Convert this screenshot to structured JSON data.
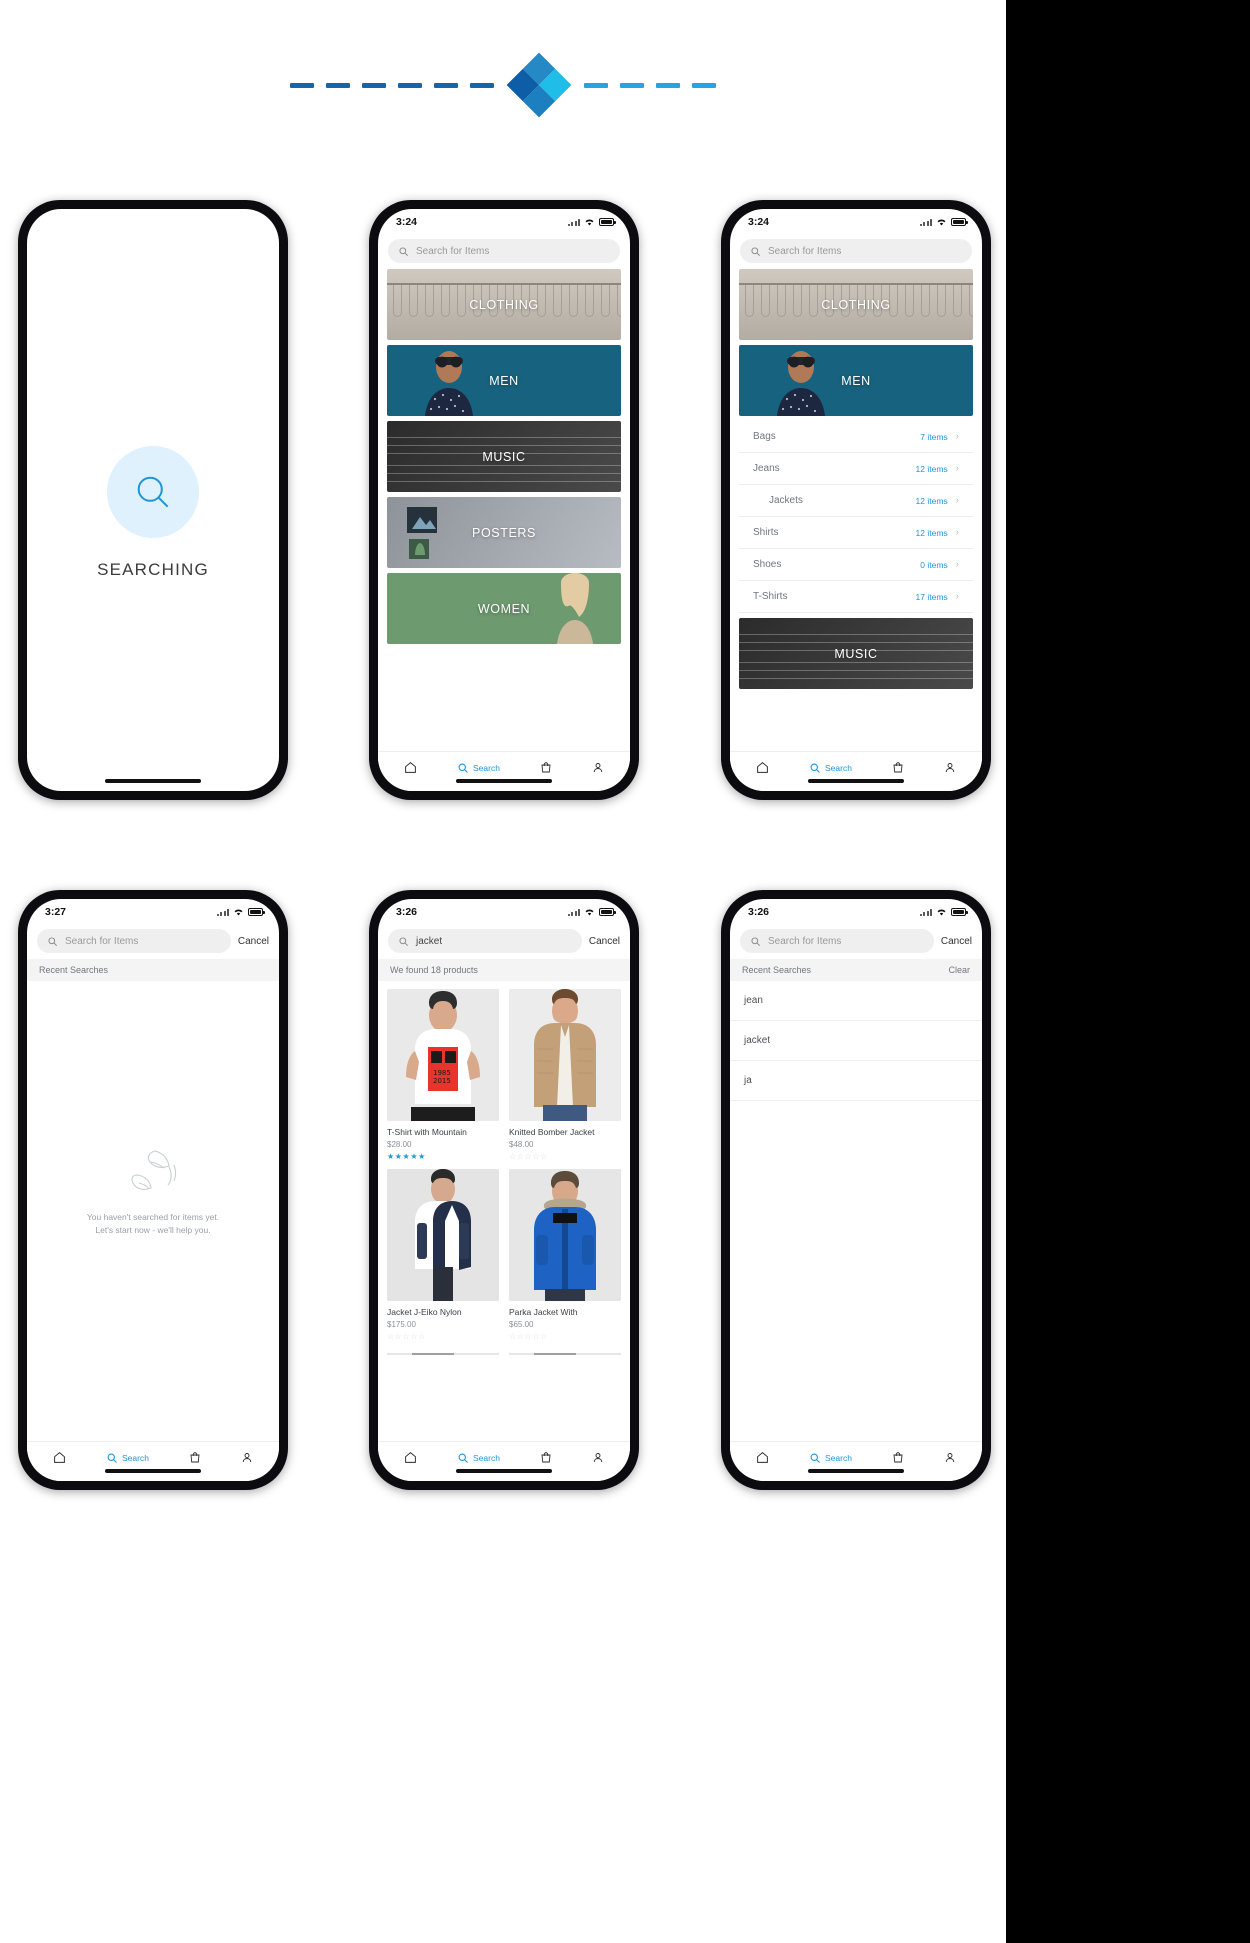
{
  "logo": {
    "name": "diamond-logo",
    "colors": [
      "#2489c4",
      "#1b7fc0",
      "#0d5ea6",
      "#1fbde8"
    ],
    "dash_color": "#1565a8"
  },
  "accent_color": "#2196d6",
  "common": {
    "search_placeholder": "Search for Items",
    "cancel_label": "Cancel",
    "nav": [
      {
        "icon": "home-icon",
        "label": ""
      },
      {
        "icon": "search-icon",
        "label": "Search"
      },
      {
        "icon": "bag-icon",
        "label": ""
      },
      {
        "icon": "person-icon",
        "label": ""
      }
    ]
  },
  "screens": [
    {
      "id": "searching",
      "status": {
        "time": "",
        "show": false
      },
      "searching_label": "SEARCHING",
      "icon": "search-icon"
    },
    {
      "id": "categories",
      "status": {
        "time": "3:24",
        "show": true
      },
      "search_value": "",
      "tiles": [
        {
          "label": "CLOTHING",
          "style": "clothing"
        },
        {
          "label": "MEN",
          "style": "men"
        },
        {
          "label": "MUSIC",
          "style": "music"
        },
        {
          "label": "POSTERS",
          "style": "posters"
        },
        {
          "label": "WOMEN",
          "style": "women"
        }
      ]
    },
    {
      "id": "category-expanded",
      "status": {
        "time": "3:24",
        "show": true
      },
      "search_value": "",
      "tiles_top": [
        {
          "label": "CLOTHING",
          "style": "clothing"
        },
        {
          "label": "MEN",
          "style": "men"
        }
      ],
      "subcategories": [
        {
          "name": "Bags",
          "count": "7 items",
          "indent": false
        },
        {
          "name": "Jeans",
          "count": "12 items",
          "indent": false
        },
        {
          "name": "Jackets",
          "count": "12 items",
          "indent": true
        },
        {
          "name": "Shirts",
          "count": "12 items",
          "indent": false
        },
        {
          "name": "Shoes",
          "count": "0 items",
          "indent": false
        },
        {
          "name": "T-Shirts",
          "count": "17 items",
          "indent": false
        }
      ],
      "tiles_bottom": [
        {
          "label": "MUSIC",
          "style": "music"
        }
      ]
    },
    {
      "id": "recent-empty",
      "status": {
        "time": "3:27",
        "show": true
      },
      "search_value": "",
      "section_title": "Recent Searches",
      "empty_line1": "You haven't searched for items yet.",
      "empty_line2": "Let's start now - we'll help you."
    },
    {
      "id": "results",
      "status": {
        "time": "3:26",
        "show": true
      },
      "search_value": "jacket",
      "results_label": "We found 18 products",
      "products": [
        {
          "name": "T-Shirt with Mountain",
          "price": "$28.00",
          "rating": 5,
          "image": "tshirt-mountain"
        },
        {
          "name": "Knitted Bomber Jacket",
          "price": "$48.00",
          "rating": 0,
          "image": "bomber-jacket"
        },
        {
          "name": "Jacket J-Eiko Nylon",
          "price": "$175.00",
          "rating": 0,
          "image": "nylon-jacket"
        },
        {
          "name": "Parka Jacket With",
          "price": "$65.00",
          "rating": 0,
          "image": "parka-jacket"
        }
      ]
    },
    {
      "id": "recent-list",
      "status": {
        "time": "3:26",
        "show": true
      },
      "search_value": "",
      "section_title": "Recent Searches",
      "clear_label": "Clear",
      "recent": [
        "jean",
        "jacket",
        "ja"
      ]
    }
  ]
}
